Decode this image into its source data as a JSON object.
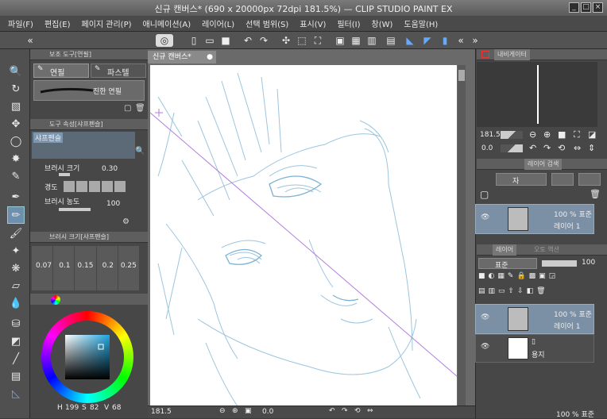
{
  "window": {
    "title": "신규 캔버스* (690 x 20000px 72dpi 181.5%) — CLIP STUDIO PAINT EX",
    "controls": [
      "_",
      "□",
      "×"
    ]
  },
  "menu": [
    "파일(F)",
    "편집(E)",
    "페이지 관리(P)",
    "애니메이션(A)",
    "레이어(L)",
    "선택 범위(S)",
    "표시(V)",
    "필터(I)",
    "창(W)",
    "도움말(H)"
  ],
  "canvas_tab": "신규 캔버스*",
  "left_panels": {
    "subtool_header": "보조 도구[연필]",
    "subtool_tabs": [
      "연필",
      "파스텔"
    ],
    "brush_name": "진한 연필",
    "toolprop_header": "도구 속성[샤프펜슬]",
    "toolprop_name": "샤프펜슬",
    "brush_size_label": "브러시 크기",
    "brush_size_value": "0.30",
    "hardness_label": "경도",
    "density_label": "브러시 농도",
    "density_value": "100",
    "brushsize_header": "브러시 크기[샤프펜슬]",
    "size_presets": [
      "0.07",
      "0.1",
      "0.15",
      "0.2",
      "0.25"
    ],
    "color_h": "199",
    "color_s": "82",
    "color_v": "68",
    "h_label": "H",
    "s_label": "S",
    "v_label": "V"
  },
  "status": {
    "zoom": "181.5",
    "angle": "0.0"
  },
  "navigator": {
    "header": "내비게이터",
    "zoom": "181.5",
    "angle": "0.0"
  },
  "layer_search": {
    "header": "레이어 검색",
    "mode_label": "자",
    "layer_opacity": "100 % 표준",
    "layer_name": "레이어 1"
  },
  "layer_panel": {
    "header": "레이어",
    "header2": "오토 액션",
    "blend": "표준",
    "opacity": "100",
    "layers": [
      {
        "opacity": "100 % 표준",
        "name": "레이어 1"
      },
      {
        "opacity": "",
        "name": "용지"
      }
    ],
    "bottom_partial": "100 % 표준"
  }
}
